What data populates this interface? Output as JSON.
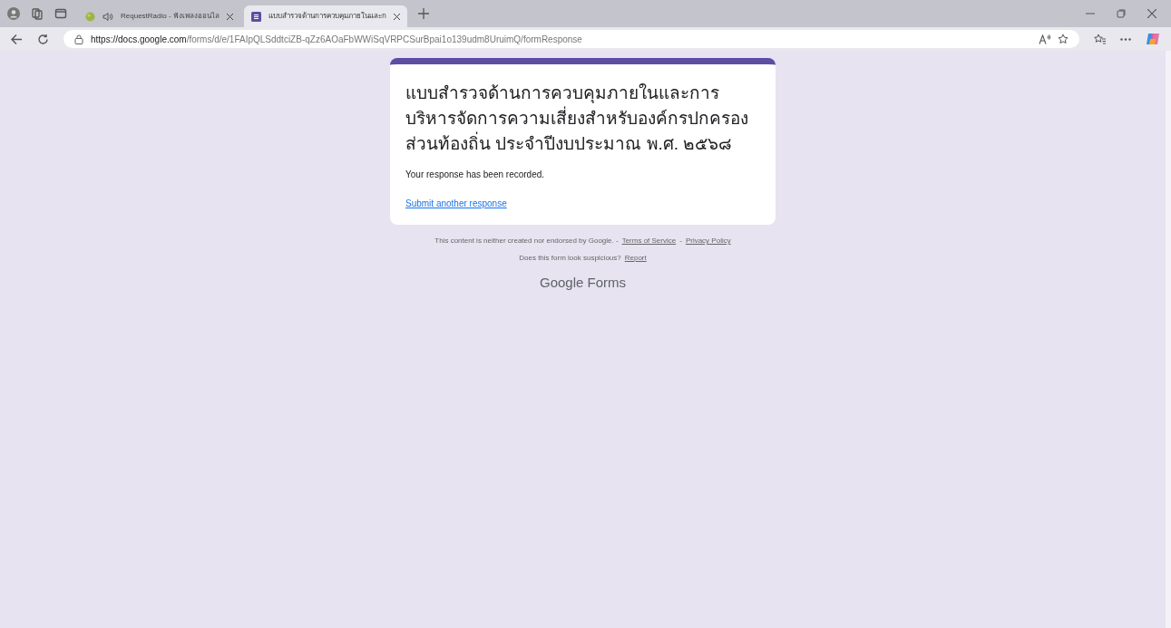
{
  "browser": {
    "tabs": [
      {
        "title": "RequestRadio - ฟังเพลงออนไล",
        "selected": false
      },
      {
        "title": "แบบสำรวจด้านการควบคุมภายในและก",
        "selected": true
      }
    ],
    "url_host": "https://docs.google.com",
    "url_path": "/forms/d/e/1FAIpQLSddtciZB-qZz6AOaFbWWiSqVRPCSurBpai1o139udm8UruimQ/formResponse"
  },
  "form": {
    "title": "แบบสำรวจด้านการควบคุมภายในและการบริหารจัดการความเสี่ยงสำหรับองค์กรปกครองส่วนท้องถิ่น ประจำปีงบประมาณ พ.ศ. ๒๕๖๘",
    "confirmation": "Your response has been recorded.",
    "link": "Submit another response"
  },
  "footer": {
    "disclaimer": "This content is neither created nor endorsed by Google. -",
    "terms": "Terms of Service",
    "separator": "-",
    "privacy": "Privacy Policy",
    "suspicious": "Does this form look suspicious?",
    "report": "Report",
    "brand": "Google Forms"
  }
}
